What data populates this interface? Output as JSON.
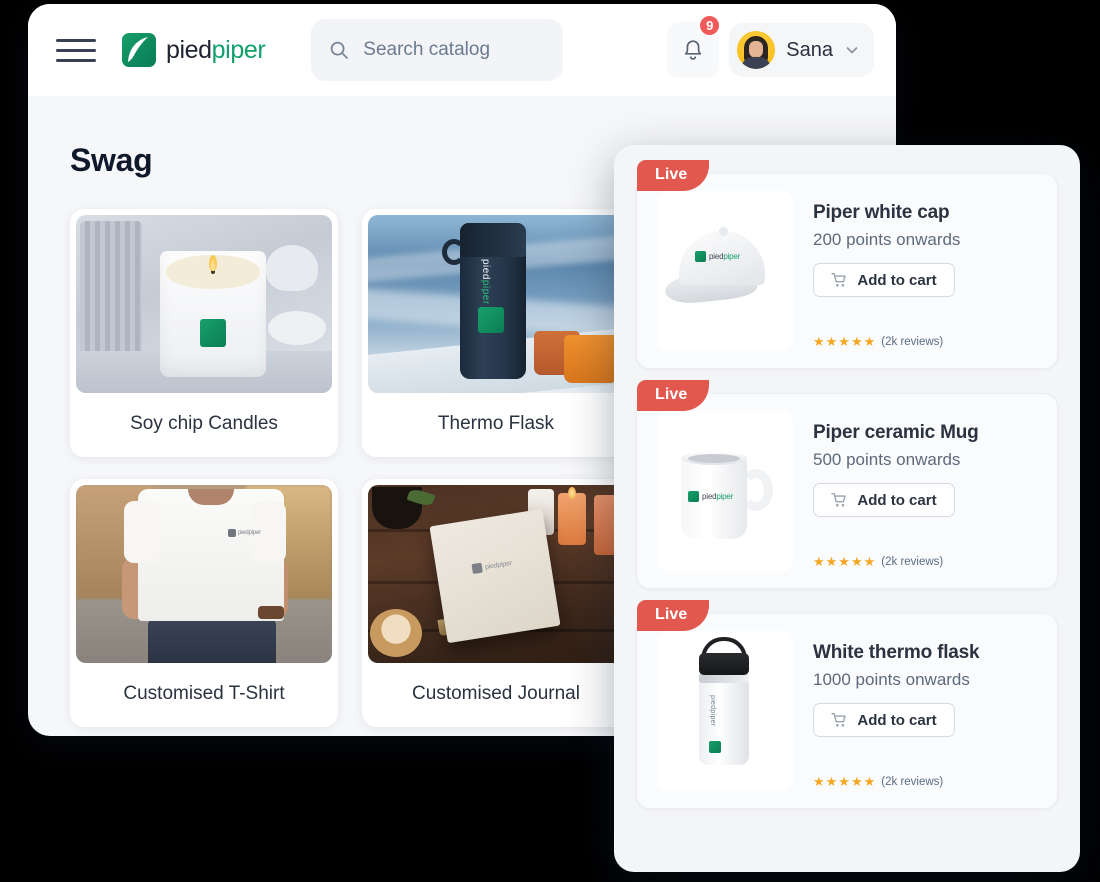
{
  "app": {
    "brand_first": "pied",
    "brand_second": "piper",
    "brand_mark_icon": "piedpiper-leaf-logo"
  },
  "topbar": {
    "menu_icon": "hamburger-menu-icon",
    "search": {
      "icon": "search-icon",
      "placeholder": "Search catalog",
      "value": ""
    },
    "notifications": {
      "icon": "bell-icon",
      "count": "9"
    },
    "user": {
      "name": "Sana",
      "avatar_icon": "user-avatar",
      "chevron_icon": "chevron-down-icon"
    }
  },
  "main": {
    "page_title": "Swag",
    "swag_items": [
      {
        "name": "Soy chip Candles",
        "image_alt": "white-soy-candle-with-logo"
      },
      {
        "name": "Thermo Flask",
        "image_alt": "navy-thermo-flask-on-mountain"
      },
      {
        "name": "Customised T-Shirt",
        "image_alt": "man-wearing-white-logo-tshirt"
      },
      {
        "name": "Customised Journal",
        "image_alt": "white-journal-on-wooden-table"
      }
    ]
  },
  "panel": {
    "products": [
      {
        "badge": "Live",
        "name": "Piper white cap",
        "points": "200 points onwards",
        "cart_label": "Add to cart",
        "cart_icon": "shopping-cart-icon",
        "stars": "★★★★★",
        "reviews": "(2k reviews)",
        "image_alt": "white-baseball-cap-with-logo"
      },
      {
        "badge": "Live",
        "name": "Piper ceramic Mug",
        "points": "500 points onwards",
        "cart_label": "Add to cart",
        "cart_icon": "shopping-cart-icon",
        "stars": "★★★★★",
        "reviews": "(2k reviews)",
        "image_alt": "white-ceramic-mug-with-logo"
      },
      {
        "badge": "Live",
        "name": "White thermo flask",
        "points": "1000 points onwards",
        "cart_label": "Add to cart",
        "cart_icon": "shopping-cart-icon",
        "stars": "★★★★★",
        "reviews": "(2k reviews)",
        "image_alt": "white-thermo-flask-with-handle"
      }
    ]
  },
  "colors": {
    "brand_green": "#12a06b",
    "badge_red": "#e2584f",
    "notification_red": "#f05a5a",
    "star_amber": "#f5a623",
    "text_dark": "#2c3340"
  }
}
